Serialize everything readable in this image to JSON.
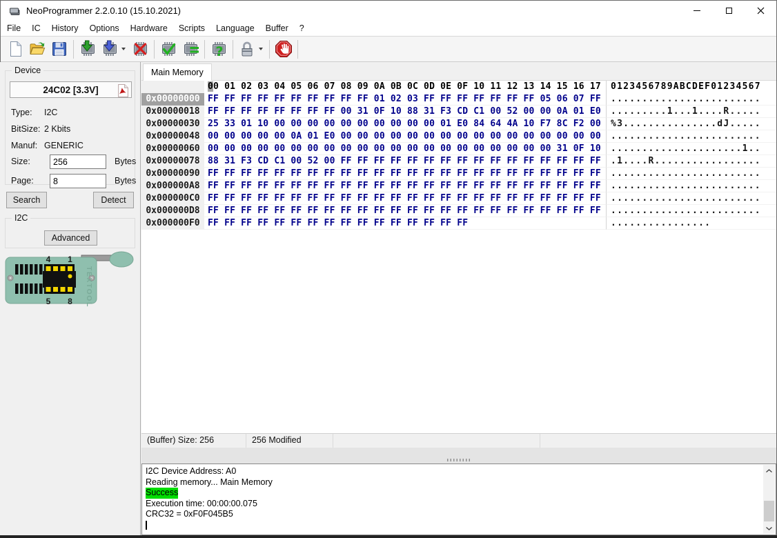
{
  "window": {
    "title": "NeoProgrammer 2.2.0.10 (15.10.2021)",
    "app_icon": "chip-icon",
    "controls": [
      "minimize",
      "maximize",
      "close"
    ]
  },
  "menu": {
    "items": [
      "File",
      "IC",
      "History",
      "Options",
      "Hardware",
      "Scripts",
      "Language",
      "Buffer",
      "?"
    ]
  },
  "toolbar": {
    "buttons": [
      {
        "icon": "new-file-icon"
      },
      {
        "icon": "open-file-icon"
      },
      {
        "icon": "save-file-icon"
      },
      {
        "separator": true
      },
      {
        "icon": "read-chip-icon"
      },
      {
        "icon": "write-chip-icon",
        "dropdown": true
      },
      {
        "icon": "erase-chip-icon"
      },
      {
        "separator": true
      },
      {
        "icon": "verify-chip-icon"
      },
      {
        "icon": "compare-chip-icon"
      },
      {
        "separator": true
      },
      {
        "icon": "blank-check-chip-icon"
      },
      {
        "separator": true
      },
      {
        "icon": "lock-icon",
        "dropdown": true
      },
      {
        "separator": true
      },
      {
        "icon": "stop-icon"
      },
      {
        "separator": true
      }
    ]
  },
  "device_panel": {
    "group_label": "Device",
    "device_name": "24C02 [3.3V]",
    "pdf_icon": "pdf-datasheet-icon",
    "info_rows": [
      {
        "label": "Type:",
        "value": "I2C"
      },
      {
        "label": "BitSize:",
        "value": "2 Kbits"
      },
      {
        "label": "Manuf:",
        "value": "GENERIC"
      }
    ],
    "size_field": {
      "label": "Size:",
      "value": "256",
      "unit": "Bytes"
    },
    "page_field": {
      "label": "Page:",
      "value": "8",
      "unit": "Bytes"
    },
    "search_button": "Search",
    "detect_button": "Detect",
    "i2c_group_label": "I2C",
    "advanced_button": "Advanced",
    "socket": {
      "pin_top_left": "4",
      "pin_top_right": "1",
      "pin_bottom_left": "5",
      "pin_bottom_right": "8",
      "brand": "TEXTOOL"
    }
  },
  "hex_editor": {
    "tab_label": "Main Memory",
    "column_header": "00 01 02 03 04 05 06 07 08 09 0A 0B 0C 0D 0E 0F 10 11 12 13 14 15 16 17",
    "ascii_header": "0123456789ABCDEF01234567",
    "selected_row": 0,
    "rows": [
      {
        "address": "0x00000000",
        "hex": "FF FF FF FF FF FF FF FF FF FF 01 02 03 FF FF FF FF FF FF FF 05 06 07 FF",
        "ascii": "........................"
      },
      {
        "address": "0x00000018",
        "hex": "FF FF FF FF FF FF FF FF 00 31 0F 10 88 31 F3 CD C1 00 52 00 00 0A 01 E0",
        "ascii": ".........1...1....R....."
      },
      {
        "address": "0x00000030",
        "hex": "25 33 01 10 00 00 00 00 00 00 00 00 00 00 01 E0 84 64 4A 10 F7 8C F2 00",
        "ascii": "%3...............dJ....."
      },
      {
        "address": "0x00000048",
        "hex": "00 00 00 00 00 0A 01 E0 00 00 00 00 00 00 00 00 00 00 00 00 00 00 00 00",
        "ascii": "........................"
      },
      {
        "address": "0x00000060",
        "hex": "00 00 00 00 00 00 00 00 00 00 00 00 00 00 00 00 00 00 00 00 00 31 0F 10",
        "ascii": ".....................1.."
      },
      {
        "address": "0x00000078",
        "hex": "88 31 F3 CD C1 00 52 00 FF FF FF FF FF FF FF FF FF FF FF FF FF FF FF FF",
        "ascii": ".1....R................."
      },
      {
        "address": "0x00000090",
        "hex": "FF FF FF FF FF FF FF FF FF FF FF FF FF FF FF FF FF FF FF FF FF FF FF FF",
        "ascii": "........................"
      },
      {
        "address": "0x000000A8",
        "hex": "FF FF FF FF FF FF FF FF FF FF FF FF FF FF FF FF FF FF FF FF FF FF FF FF",
        "ascii": "........................"
      },
      {
        "address": "0x000000C0",
        "hex": "FF FF FF FF FF FF FF FF FF FF FF FF FF FF FF FF FF FF FF FF FF FF FF FF",
        "ascii": "........................"
      },
      {
        "address": "0x000000D8",
        "hex": "FF FF FF FF FF FF FF FF FF FF FF FF FF FF FF FF FF FF FF FF FF FF FF FF",
        "ascii": "........................"
      },
      {
        "address": "0x000000F0",
        "hex": "FF FF FF FF FF FF FF FF FF FF FF FF FF FF FF FF",
        "ascii": "................"
      }
    ]
  },
  "status_bar": {
    "segments": [
      "(Buffer) Size: 256",
      "256 Modified",
      "",
      ""
    ]
  },
  "log_panel": {
    "lines": [
      {
        "text": "I2C Device Address: A0",
        "highlight": false
      },
      {
        "text": "Reading memory... Main Memory",
        "highlight": false
      },
      {
        "text": "Success",
        "highlight": true
      },
      {
        "text": "Execution time: 00:00:00.075",
        "highlight": false
      },
      {
        "text": "CRC32 = 0xF0F045B5",
        "highlight": false
      }
    ]
  },
  "colors": {
    "hex_byte_text": "#00008b",
    "selected_address_bg": "#a0a0a0",
    "success_highlight": "#00dc00",
    "socket_teal": "#8fbfae",
    "stop_red": "#cf2020",
    "window_bg": "#f0f0f0"
  }
}
